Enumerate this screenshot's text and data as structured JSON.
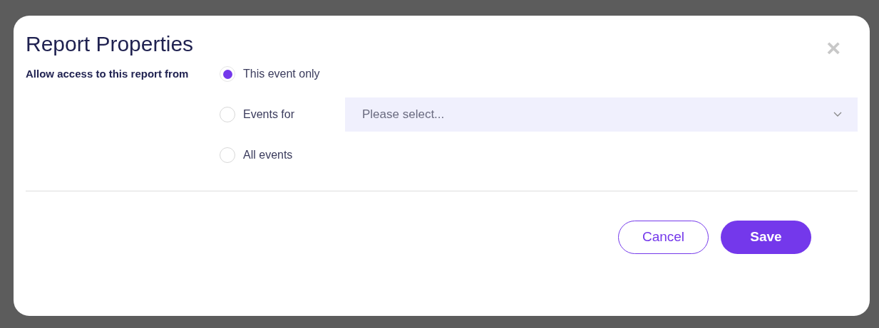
{
  "dialog": {
    "title": "Report Properties",
    "close": "×"
  },
  "access": {
    "label": "Allow access to this report from",
    "options": [
      {
        "label": "This event only",
        "selected": true,
        "kind": "plain"
      },
      {
        "label": "Events for",
        "selected": false,
        "kind": "select",
        "placeholder": "Please select..."
      },
      {
        "label": "All events",
        "selected": false,
        "kind": "plain"
      }
    ]
  },
  "buttons": [
    {
      "label": "Cancel",
      "kind": "secondary"
    },
    {
      "label": "Save",
      "kind": "primary"
    }
  ]
}
